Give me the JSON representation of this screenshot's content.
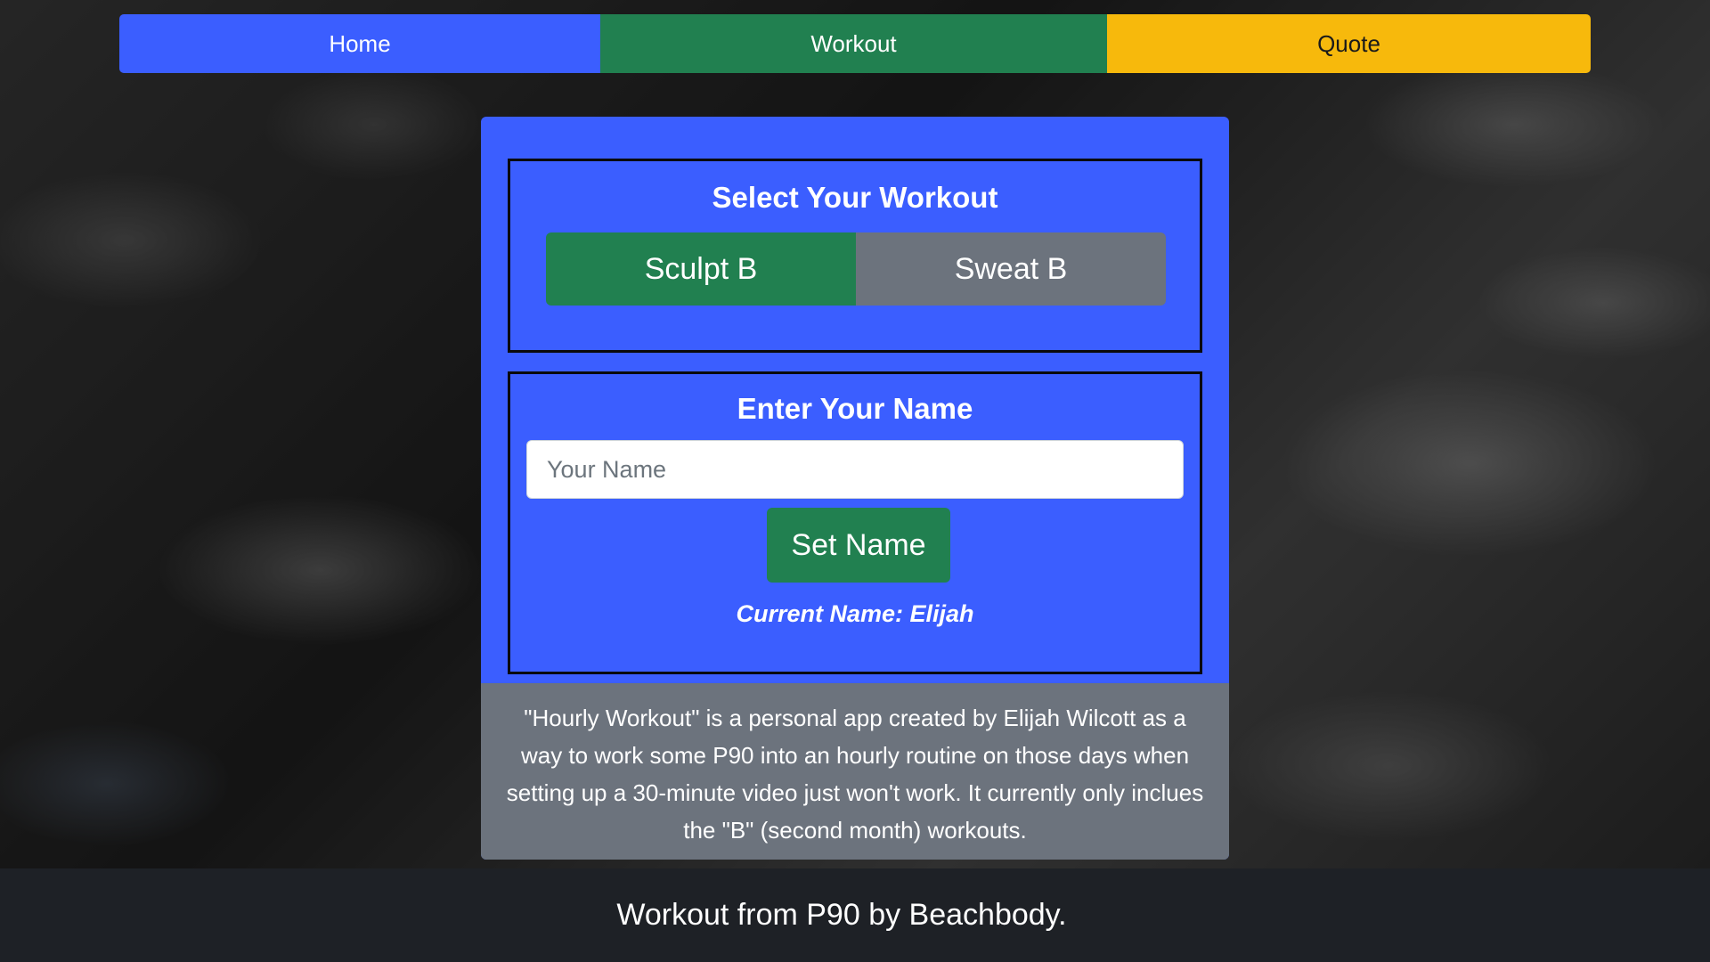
{
  "nav": {
    "home": "Home",
    "workout": "Workout",
    "quote": "Quote"
  },
  "workout_panel": {
    "title": "Select Your Workout",
    "options": [
      "Sculpt B",
      "Sweat B"
    ],
    "selected": "Sculpt B"
  },
  "name_panel": {
    "title": "Enter Your Name",
    "input_placeholder": "Your Name",
    "input_value": "",
    "button_label": "Set Name",
    "current_name": "Current Name: Elijah"
  },
  "about": {
    "text": "\"Hourly Workout\" is a personal app created by Elijah Wilcott as a way to work some P90 into an hourly routine on those days when setting up a 30-minute video just won't work. It currently only inclues the \"B\" (second month) workouts."
  },
  "footer": {
    "text": "Workout from P90 by Beachbody."
  },
  "colors": {
    "primary_blue": "#3b5eff",
    "success_green": "#218050",
    "warning_yellow": "#f7b90c",
    "secondary_gray": "#6c737d",
    "footer_dark": "#1e2126"
  }
}
